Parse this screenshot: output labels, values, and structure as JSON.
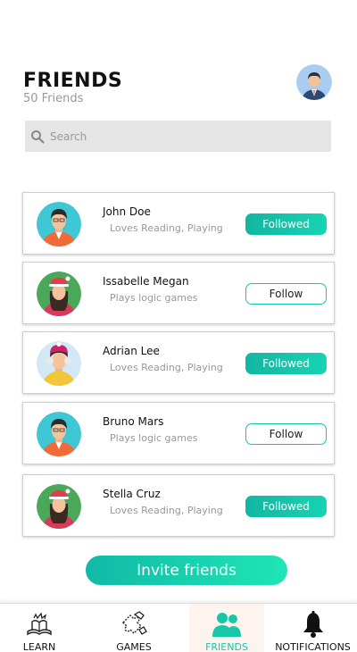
{
  "header": {
    "title": "FRIENDS",
    "count": "50 Friends"
  },
  "search": {
    "placeholder": "Search"
  },
  "friends": [
    {
      "name": "John Doe",
      "desc": "Loves Reading, Playing",
      "button": "Followed",
      "status": "followed"
    },
    {
      "name": "Issabelle Megan",
      "desc": "Plays logic games",
      "button": "Follow",
      "status": "follow"
    },
    {
      "name": "Adrian Lee",
      "desc": "Loves Reading, Playing",
      "button": "Followed",
      "status": "followed"
    },
    {
      "name": "Bruno Mars",
      "desc": "Plays logic games",
      "button": "Follow",
      "status": "follow"
    },
    {
      "name": "Stella Cruz",
      "desc": "Loves Reading, Playing",
      "button": "Followed",
      "status": "followed"
    }
  ],
  "invite_label": "Invite friends",
  "nav": [
    {
      "label": "LEARN",
      "icon": "open-book-icon",
      "active": false
    },
    {
      "label": "GAMES",
      "icon": "puzzle-icon",
      "active": false
    },
    {
      "label": "FRIENDS",
      "icon": "people-icon",
      "active": true
    },
    {
      "label": "NOTIFICATIONS",
      "icon": "bell-icon",
      "active": false
    }
  ],
  "colors": {
    "accent": "#17c3a6",
    "accent_dark": "#12b6a2",
    "search_bg": "#e5e5e5"
  }
}
